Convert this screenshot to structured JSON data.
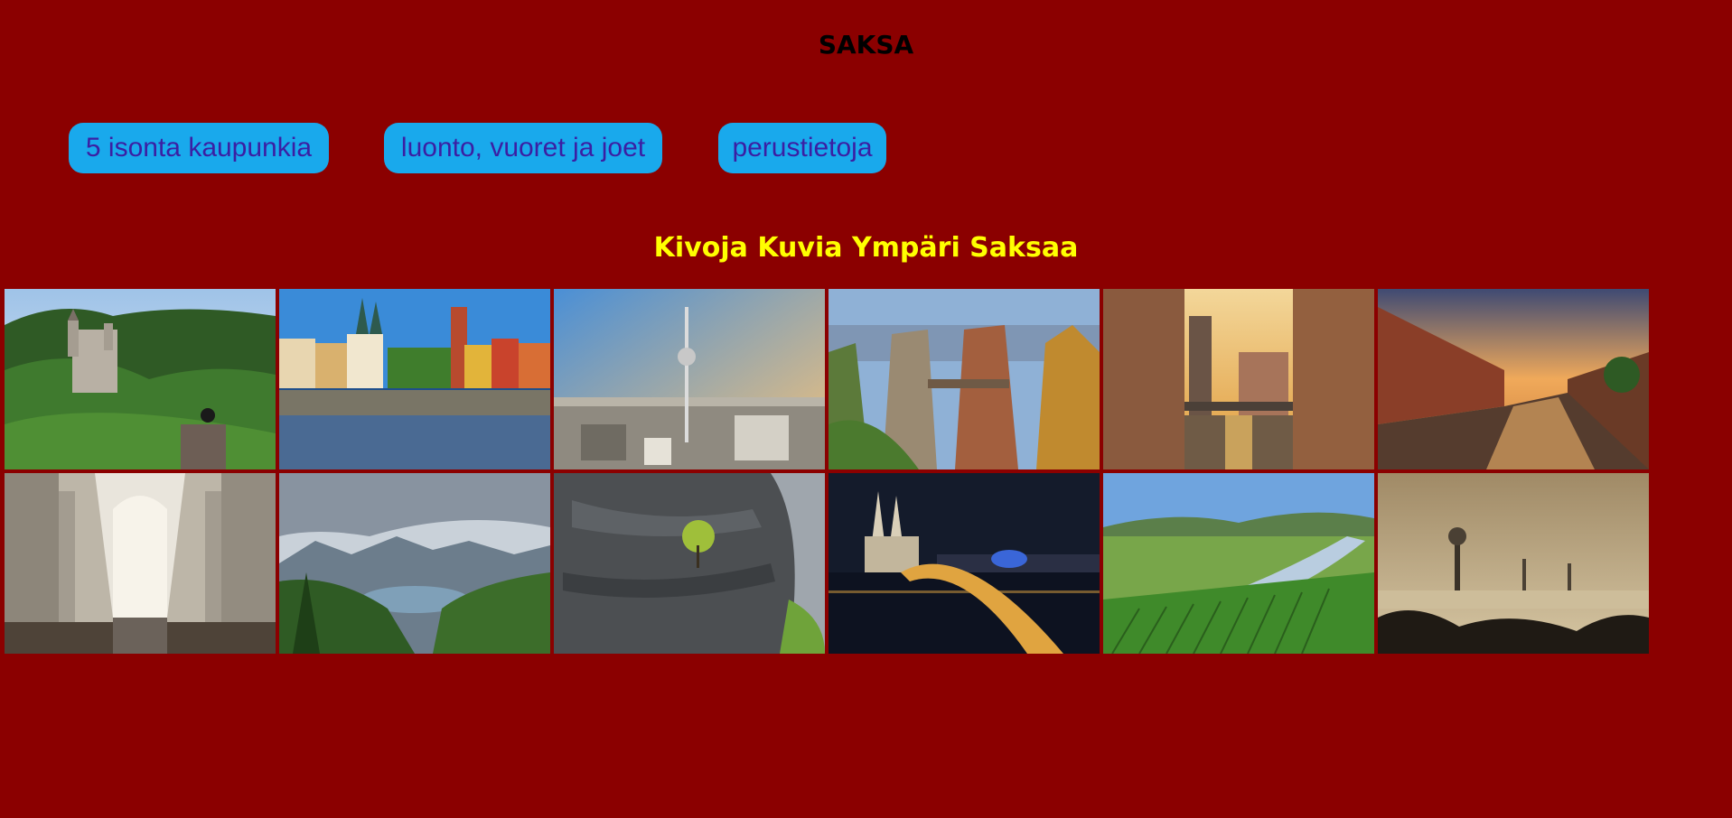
{
  "header": {
    "title": "SAKSA"
  },
  "nav": {
    "buttons": [
      {
        "label": "5 isonta kaupunkia"
      },
      {
        "label": "luonto, vuoret ja joet"
      },
      {
        "label": "perustietoja"
      }
    ]
  },
  "gallery": {
    "heading": "Kivoja Kuvia Ympäri Saksaa",
    "photos": [
      {
        "subject": "castle-in-forest"
      },
      {
        "subject": "old-town-waterfront"
      },
      {
        "subject": "tv-tower-city"
      },
      {
        "subject": "sandstone-rock-bridge"
      },
      {
        "subject": "warehouse-canal-sunset"
      },
      {
        "subject": "brick-warehouses-canal"
      },
      {
        "subject": "cathedral-interior"
      },
      {
        "subject": "alpine-lake-mountains"
      },
      {
        "subject": "rock-cliff-tree"
      },
      {
        "subject": "cathedral-bridge-night"
      },
      {
        "subject": "river-vineyards"
      },
      {
        "subject": "industrial-smog-landscape"
      }
    ]
  },
  "colors": {
    "background": "#8b0000",
    "button_bg": "#19a9ec",
    "button_text": "#3b1fa3",
    "heading_text": "#ffff00"
  }
}
